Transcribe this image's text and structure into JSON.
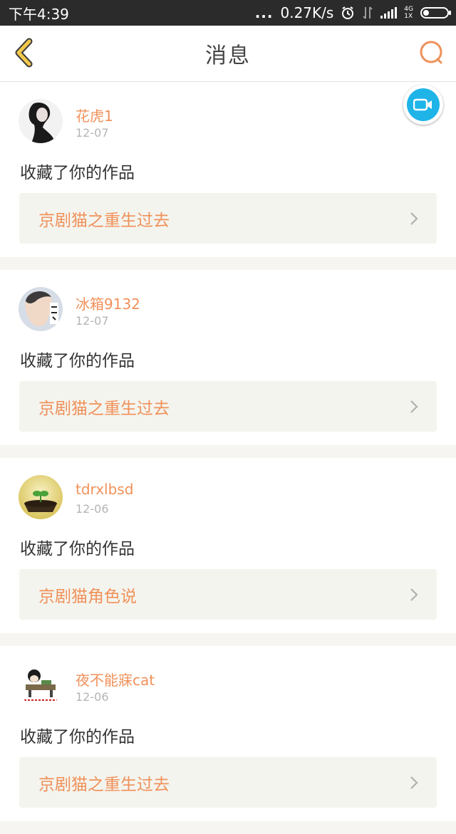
{
  "status_bar": {
    "time": "下午4:39",
    "dots": "...",
    "speed": "0.27K/s",
    "net_top": "4G",
    "net_bottom": "1X"
  },
  "header": {
    "title": "消息"
  },
  "colors": {
    "accent": "#f0915a",
    "camera": "#1fb4e8",
    "back": "#f2c94c"
  },
  "messages": [
    {
      "username": "花虎1",
      "date": "12-07",
      "action": "收藏了你的作品",
      "work_title": "京剧猫之重生过去"
    },
    {
      "username": "冰箱9132",
      "date": "12-07",
      "action": "收藏了你的作品",
      "work_title": "京剧猫之重生过去"
    },
    {
      "username": "tdrxlbsd",
      "date": "12-06",
      "action": "收藏了你的作品",
      "work_title": "京剧猫角色说"
    },
    {
      "username": "夜不能寐cat",
      "date": "12-06",
      "action": "收藏了你的作品",
      "work_title": "京剧猫之重生过去"
    }
  ]
}
